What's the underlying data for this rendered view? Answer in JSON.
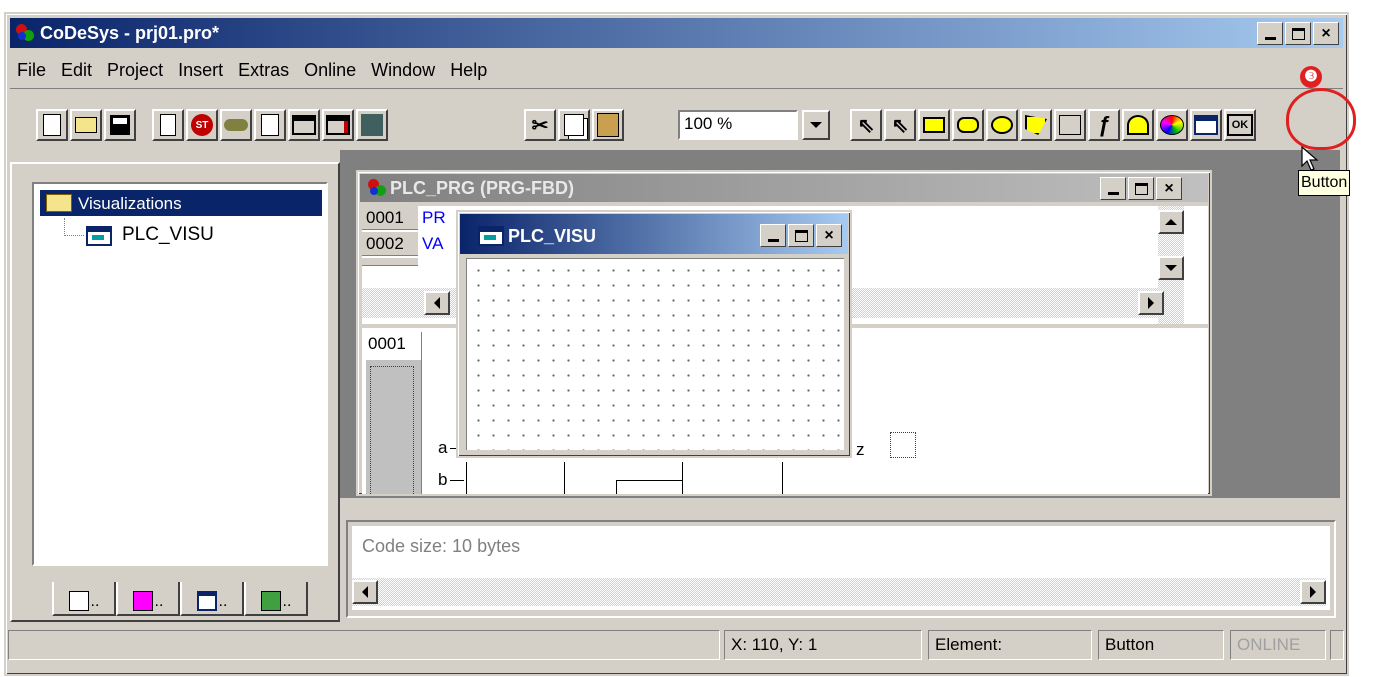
{
  "window": {
    "title": "CoDeSys - prj01.pro*",
    "min": "_",
    "max": "□",
    "close": "×"
  },
  "menu": [
    "File",
    "Edit",
    "Project",
    "Insert",
    "Extras",
    "Online",
    "Window",
    "Help"
  ],
  "toolbar": {
    "zoom_value": "100 %"
  },
  "tree": {
    "root": "Visualizations",
    "child": "PLC_VISU"
  },
  "prg": {
    "title": "PLC_PRG (PRG-FBD)",
    "lines": [
      {
        "num": "0001",
        "text": "PR"
      },
      {
        "num": "0002",
        "text": "VA"
      }
    ],
    "fbd_line": "0001",
    "inputs": [
      "a",
      "b"
    ],
    "output": "z"
  },
  "visu": {
    "title": "PLC_VISU"
  },
  "messages": {
    "text": "Code size: 10 bytes"
  },
  "status": {
    "coords": "X:   110, Y:     1",
    "element_label": "Element:",
    "element_value": "Button",
    "online": "ONLINE"
  },
  "annotation": {
    "step": "❸",
    "tooltip": "Button"
  },
  "colors": {
    "title_active": "#0a246a",
    "title_inactive": "#808080",
    "face": "#d4d0c8",
    "annotation": "#e02020"
  }
}
